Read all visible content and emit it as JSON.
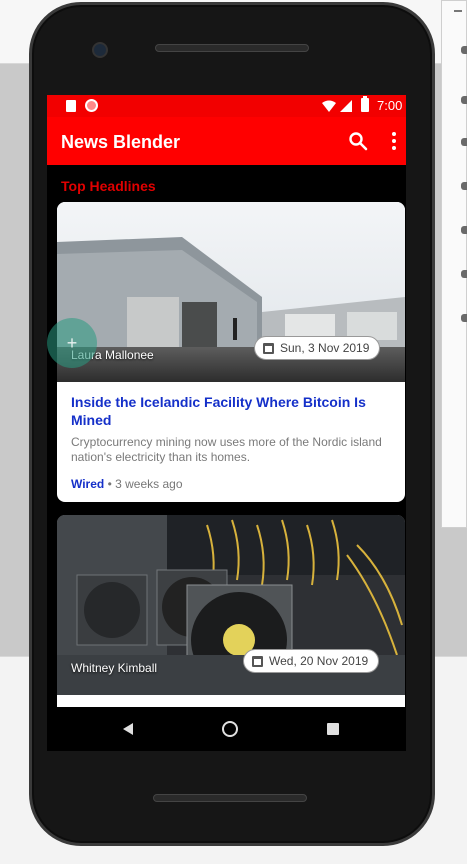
{
  "status_bar": {
    "time": "7:00"
  },
  "app_bar": {
    "title": "News Blender"
  },
  "section": {
    "title": "Top Headlines"
  },
  "articles": [
    {
      "author": "Laura Mallonee",
      "date": "Sun, 3 Nov 2019",
      "title": "Inside the Icelandic Facility Where Bitcoin Is Mined",
      "description": "Cryptocurrency mining now uses more of the Nordic island nation's electricity than its homes.",
      "source": "Wired",
      "age": "3 weeks ago",
      "separator": "•"
    },
    {
      "author": "Whitney Kimball",
      "date": "Wed, 20 Nov 2019"
    }
  ],
  "fab": {
    "label": "+"
  },
  "colors": {
    "primary": "#ff0000",
    "headline": "#1530c9",
    "section_title": "#e00000"
  }
}
